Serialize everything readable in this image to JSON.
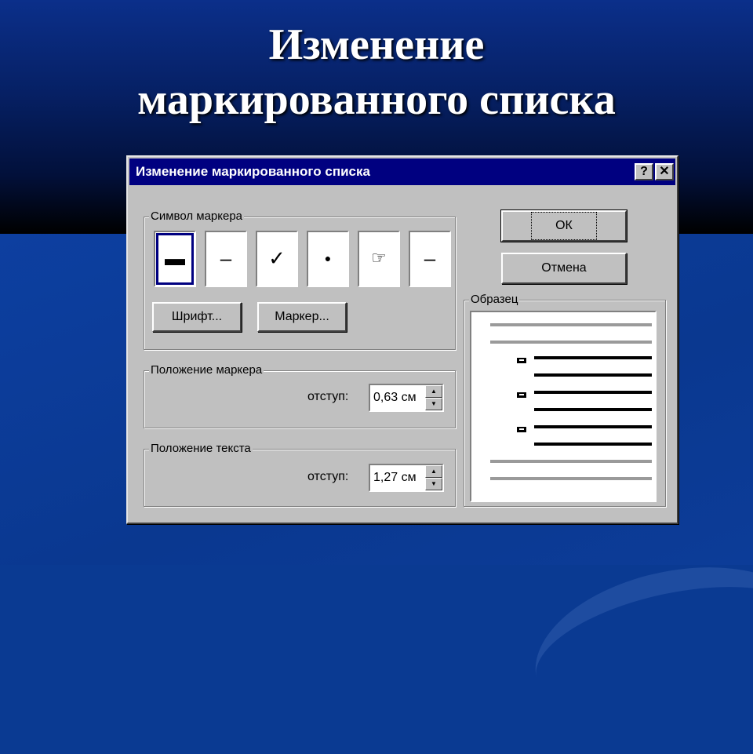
{
  "slide": {
    "title": "Изменение маркированного списка"
  },
  "dialog": {
    "title": "Изменение маркированного списка",
    "help_label": "?",
    "close_label": "✕",
    "symbol_group": {
      "label": "Символ маркера",
      "markers": [
        "▬",
        "–",
        "✓",
        "●",
        "☞",
        "–"
      ],
      "selected_index": 0
    },
    "font_button": "Шрифт...",
    "marker_button": "Маркер...",
    "marker_position": {
      "label": "Положение маркера",
      "indent_label": "отступ:",
      "indent_value": "0,63 см"
    },
    "text_position": {
      "label": "Положение текста",
      "indent_label": "отступ:",
      "indent_value": "1,27 см"
    },
    "ok_button": "ОК",
    "cancel_button": "Отмена",
    "preview": {
      "label": "Образец"
    }
  },
  "colors": {
    "titlebar": "#000080",
    "dialog_face": "#c0c0c0",
    "slide_bg": "#0a3a92"
  }
}
